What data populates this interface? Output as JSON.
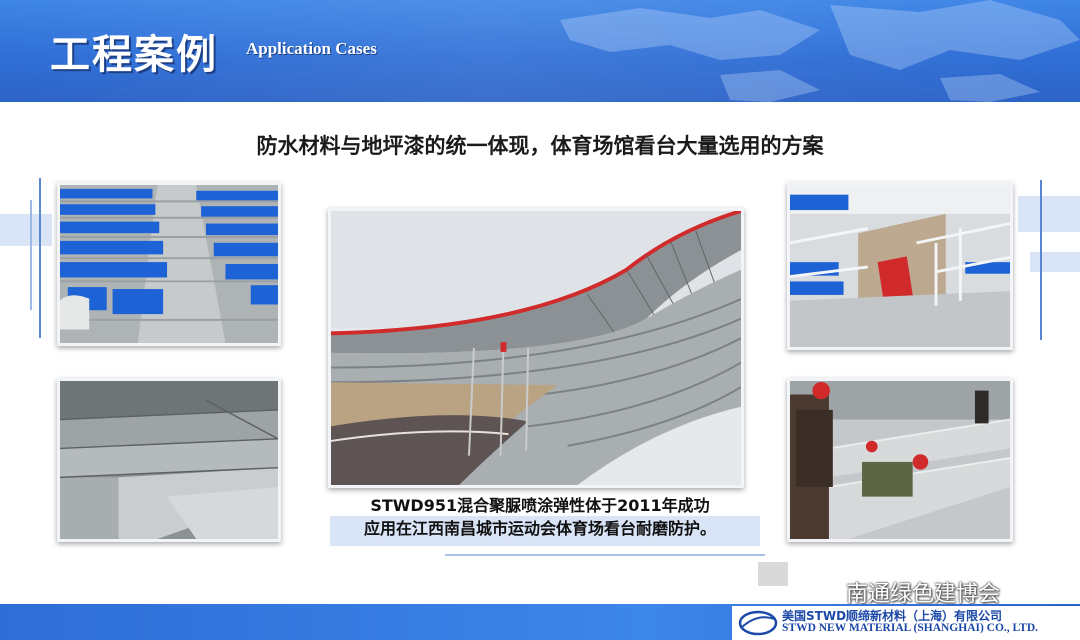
{
  "header": {
    "title_zh": "工程案例",
    "title_en": "Application Cases"
  },
  "headline": "防水材料与地坪漆的统一体现，体育场馆看台大量选用的方案",
  "photos": [
    {
      "name": "blue-stadium-seats-photo"
    },
    {
      "name": "concrete-stairs-photo"
    },
    {
      "name": "nanchang-stadium-photo"
    },
    {
      "name": "stand-steps-red-photo"
    },
    {
      "name": "workers-spraying-photo"
    }
  ],
  "caption": {
    "line1": "STWD951混合聚脲喷涂弹性体于2011年成功",
    "line2": "应用在江西南昌城市运动会体育场看台耐磨防护。"
  },
  "footer": {
    "company_zh": "美国STWD顺缔新材料（上海）有限公司",
    "company_en": "STWD NEW MATERIAL (SHANGHAI) CO., LTD."
  },
  "watermark": {
    "text": "南通绿色建博会"
  },
  "colors": {
    "header_blue": "#2f6fd6",
    "footer_blue": "#3d86ea",
    "company_blue": "#1c48a8",
    "seat_blue": "#1e63d6",
    "accent_red": "#d02a2a"
  }
}
